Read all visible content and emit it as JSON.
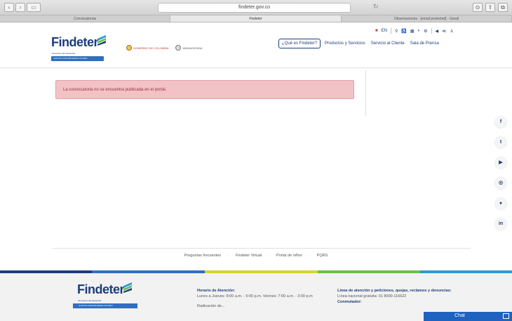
{
  "browser": {
    "url": "findeter.gov.co",
    "tabs": [
      {
        "label": "Convocatorias",
        "active": false
      },
      {
        "label": "Findeter",
        "active": true
      },
      {
        "label": "Observaciones - [email protected] - Gmail",
        "active": false
      }
    ]
  },
  "header": {
    "logo_text": "Findeter",
    "logo_sub": "Financiera del Desarrollo",
    "logo_tagline": "JUNTOS CONSTRUIMOS FUTURO",
    "gov1": "GOBIERNO DE COLOMBIA",
    "gov2": "MINHACIENDA",
    "lang": "EN",
    "menu": [
      "¿Qué es Findeter?",
      "Productos y Servicios",
      "Servicio al Cliente",
      "Sala de Prensa"
    ]
  },
  "alert": {
    "message": "La convocatoria no se encuentra publicada en el portal."
  },
  "social": [
    "f",
    "t",
    "yt",
    "ig",
    "fl",
    "in"
  ],
  "footer_links": [
    "Preguntas frecuentes",
    "Findeter Virtual",
    "Portal de niños",
    "PQRS"
  ],
  "color_bar": [
    "#1d3d7a",
    "#2f6fc0",
    "#d6d62a",
    "#6cbf4a",
    "#2a9bd6"
  ],
  "footer": {
    "logo_text": "Findeter",
    "logo_sub": "Financiera del Desarrollo",
    "logo_tagline": "JUNTOS CONSTRUIMOS FUTURO",
    "hours_title": "Horario de Atención:",
    "hours_text": "Lunes a Jueves: 8:00 a.m. - 5:00 p.m. Viernes: 7:00 a.m. - 3:00 p.m",
    "hours_more": "Radicación de...",
    "contact_title": "Línea de atención y peticiones, quejas, reclamos y denuncias:",
    "contact_line": "Línea nacional gratuita: 01 8000-116622",
    "switch_title": "Conmutador:"
  },
  "chat": {
    "label": "Chat"
  }
}
